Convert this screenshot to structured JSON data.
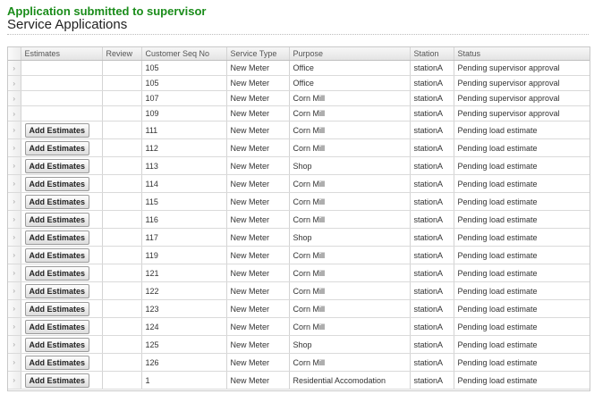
{
  "message": "Application submitted to supervisor",
  "page_title": "Service Applications",
  "grid": {
    "columns": [
      "Estimates",
      "Review",
      "Customer Seq No",
      "Service Type",
      "Purpose",
      "Station",
      "Status"
    ],
    "rows": [
      {
        "estimates_button": "",
        "review": "",
        "seq": "105",
        "service_type": "New Meter",
        "purpose": "Office",
        "station": "stationA",
        "status": "Pending supervisor approval"
      },
      {
        "estimates_button": "",
        "review": "",
        "seq": "105",
        "service_type": "New Meter",
        "purpose": "Office",
        "station": "stationA",
        "status": "Pending supervisor approval"
      },
      {
        "estimates_button": "",
        "review": "",
        "seq": "107",
        "service_type": "New Meter",
        "purpose": "Corn Mill",
        "station": "stationA",
        "status": "Pending supervisor approval"
      },
      {
        "estimates_button": "",
        "review": "",
        "seq": "109",
        "service_type": "New Meter",
        "purpose": "Corn Mill",
        "station": "stationA",
        "status": "Pending supervisor approval"
      },
      {
        "estimates_button": "Add Estimates",
        "review": "",
        "seq": "111",
        "service_type": "New Meter",
        "purpose": "Corn Mill",
        "station": "stationA",
        "status": "Pending load estimate"
      },
      {
        "estimates_button": "Add Estimates",
        "review": "",
        "seq": "112",
        "service_type": "New Meter",
        "purpose": "Corn Mill",
        "station": "stationA",
        "status": "Pending load estimate"
      },
      {
        "estimates_button": "Add Estimates",
        "review": "",
        "seq": "113",
        "service_type": "New Meter",
        "purpose": "Shop",
        "station": "stationA",
        "status": "Pending load estimate"
      },
      {
        "estimates_button": "Add Estimates",
        "review": "",
        "seq": "114",
        "service_type": "New Meter",
        "purpose": "Corn Mill",
        "station": "stationA",
        "status": "Pending load estimate"
      },
      {
        "estimates_button": "Add Estimates",
        "review": "",
        "seq": "115",
        "service_type": "New Meter",
        "purpose": "Corn Mill",
        "station": "stationA",
        "status": "Pending load estimate"
      },
      {
        "estimates_button": "Add Estimates",
        "review": "",
        "seq": "116",
        "service_type": "New Meter",
        "purpose": "Corn Mill",
        "station": "stationA",
        "status": "Pending load estimate"
      },
      {
        "estimates_button": "Add Estimates",
        "review": "",
        "seq": "117",
        "service_type": "New Meter",
        "purpose": "Shop",
        "station": "stationA",
        "status": "Pending load estimate"
      },
      {
        "estimates_button": "Add Estimates",
        "review": "",
        "seq": "119",
        "service_type": "New Meter",
        "purpose": "Corn Mill",
        "station": "stationA",
        "status": "Pending load estimate"
      },
      {
        "estimates_button": "Add Estimates",
        "review": "",
        "seq": "121",
        "service_type": "New Meter",
        "purpose": "Corn Mill",
        "station": "stationA",
        "status": "Pending load estimate"
      },
      {
        "estimates_button": "Add Estimates",
        "review": "",
        "seq": "122",
        "service_type": "New Meter",
        "purpose": "Corn Mill",
        "station": "stationA",
        "status": "Pending load estimate"
      },
      {
        "estimates_button": "Add Estimates",
        "review": "",
        "seq": "123",
        "service_type": "New Meter",
        "purpose": "Corn Mill",
        "station": "stationA",
        "status": "Pending load estimate"
      },
      {
        "estimates_button": "Add Estimates",
        "review": "",
        "seq": "124",
        "service_type": "New Meter",
        "purpose": "Corn Mill",
        "station": "stationA",
        "status": "Pending load estimate"
      },
      {
        "estimates_button": "Add Estimates",
        "review": "",
        "seq": "125",
        "service_type": "New Meter",
        "purpose": "Shop",
        "station": "stationA",
        "status": "Pending load estimate"
      },
      {
        "estimates_button": "Add Estimates",
        "review": "",
        "seq": "126",
        "service_type": "New Meter",
        "purpose": "Corn Mill",
        "station": "stationA",
        "status": "Pending load estimate"
      },
      {
        "estimates_button": "Add Estimates",
        "review": "",
        "seq": "1",
        "service_type": "New Meter",
        "purpose": "Residential Accomodation",
        "station": "stationA",
        "status": "Pending load estimate"
      }
    ]
  },
  "icons": {
    "row_indicator": "chevron-right-icon"
  }
}
